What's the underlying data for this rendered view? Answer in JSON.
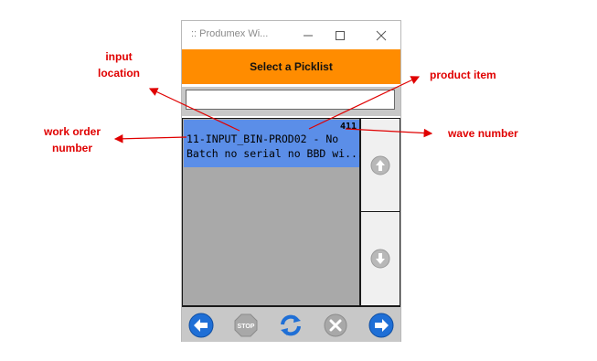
{
  "window": {
    "title": ":: Produmex Wi...",
    "minimize_icon": "minimize-icon",
    "maximize_icon": "maximize-icon",
    "close_icon": "close-icon"
  },
  "header": {
    "title": "Select a Picklist"
  },
  "search": {
    "value": "",
    "placeholder": ""
  },
  "list": {
    "items": [
      {
        "wave": "411",
        "line1": "11-INPUT_BIN-PROD02 - No",
        "line2": "Batch no serial no BBD wi..."
      }
    ]
  },
  "toolbar": {
    "buttons": [
      {
        "name": "back",
        "icon": "arrow-left-icon"
      },
      {
        "name": "stop",
        "icon": "stop-icon",
        "label": "STOP"
      },
      {
        "name": "refresh",
        "icon": "refresh-icon"
      },
      {
        "name": "cancel",
        "icon": "cancel-icon"
      },
      {
        "name": "next",
        "icon": "arrow-right-icon"
      }
    ]
  },
  "annotations": {
    "input_location": [
      "input",
      "location"
    ],
    "product_item": "product item",
    "work_order_number": [
      "work order",
      "number"
    ],
    "wave_number": "wave number",
    "color": "#e00000"
  },
  "colors": {
    "header": "#ff8c00",
    "selected": "#5b8ee8",
    "list_bg": "#a9a9a9"
  }
}
